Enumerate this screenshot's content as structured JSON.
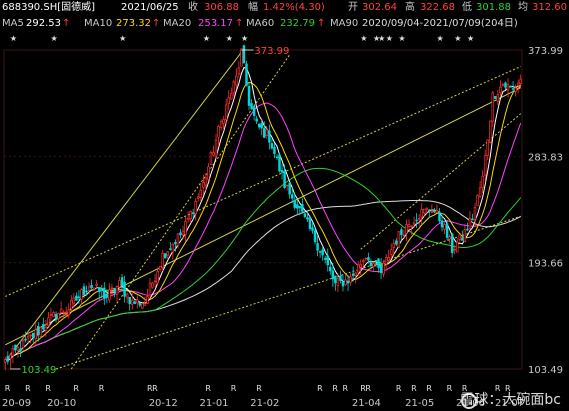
{
  "colors": {
    "background": "#000000",
    "up": "#ff3030",
    "down": "#00d8d8",
    "text": "#c8c8c8",
    "red": "#ff4040",
    "green": "#30d030",
    "channel": "#e8e84a",
    "grid": "#3a1414"
  },
  "header": {
    "code": "688390.SH[固德威]",
    "date": "2021/06/25",
    "close_label": "收",
    "close": "306.88",
    "change_label": "幅",
    "change": "1.42%(4.30)",
    "open_label": "开",
    "open": "302.64",
    "high_label": "高",
    "high": "322.68",
    "low_label": "低",
    "low": "301.88",
    "avg_label": "均",
    "avg": "312.60"
  },
  "ma": {
    "ma5_label": "MA5",
    "ma5": "292.53",
    "ma10_label": "MA10",
    "ma10": "273.32",
    "ma20_label": "MA20",
    "ma20": "253.17",
    "ma60_label": "MA60",
    "ma60": "232.79",
    "ma90_label": "MA90",
    "ma90": "2020/09/04-2021/07/09(204日)",
    "colors": {
      "ma5": "#ffffff",
      "ma10": "#ffd700",
      "ma20": "#ff40ff",
      "ma60": "#30d030",
      "ma90": "#dddddd"
    }
  },
  "annotations": {
    "high_label": "373.99",
    "low_label": "103.49",
    "star_marker": "★",
    "r_marker": "R"
  },
  "watermark": {
    "text": "雪球：大碗面bc"
  },
  "chart_data": {
    "type": "candlestick",
    "ylim": [
      103.49,
      373.99
    ],
    "y_ticks": [
      "373.99",
      "283.83",
      "193.66",
      "103.49"
    ],
    "x_ticks": [
      "20-09",
      "20-10",
      "20-12",
      "21-01",
      "21-02",
      "21-04",
      "21-05",
      "21-06",
      "21-07"
    ],
    "x_tick_index": [
      1,
      22,
      62,
      82,
      102,
      142,
      163,
      183,
      203
    ],
    "high": {
      "value": 373.99,
      "index": 93
    },
    "low": {
      "value": 103.49,
      "index": 2
    },
    "anchors": [
      [
        0,
        110
      ],
      [
        10,
        130
      ],
      [
        20,
        150
      ],
      [
        25,
        155
      ],
      [
        33,
        175
      ],
      [
        40,
        165
      ],
      [
        45,
        175
      ],
      [
        50,
        160
      ],
      [
        55,
        160
      ],
      [
        62,
        200
      ],
      [
        70,
        220
      ],
      [
        78,
        260
      ],
      [
        86,
        320
      ],
      [
        91,
        350
      ],
      [
        93,
        372
      ],
      [
        96,
        330
      ],
      [
        99,
        310
      ],
      [
        104,
        300
      ],
      [
        110,
        260
      ],
      [
        116,
        238
      ],
      [
        124,
        205
      ],
      [
        130,
        175
      ],
      [
        136,
        180
      ],
      [
        142,
        200
      ],
      [
        148,
        185
      ],
      [
        153,
        210
      ],
      [
        158,
        225
      ],
      [
        163,
        235
      ],
      [
        168,
        240
      ],
      [
        172,
        228
      ],
      [
        176,
        205
      ],
      [
        180,
        215
      ],
      [
        184,
        232
      ],
      [
        188,
        265
      ],
      [
        192,
        335
      ],
      [
        196,
        345
      ],
      [
        200,
        340
      ],
      [
        203,
        350
      ]
    ],
    "star_index": [
      3,
      19,
      46,
      79,
      88,
      94,
      141,
      146,
      148,
      151,
      156,
      171,
      178,
      183
    ],
    "r_index_bottom": [
      1,
      9,
      17,
      28,
      38,
      57,
      59,
      80,
      90,
      100,
      124,
      130,
      134,
      141,
      143,
      155,
      161,
      167,
      175,
      181,
      194,
      198
    ]
  }
}
